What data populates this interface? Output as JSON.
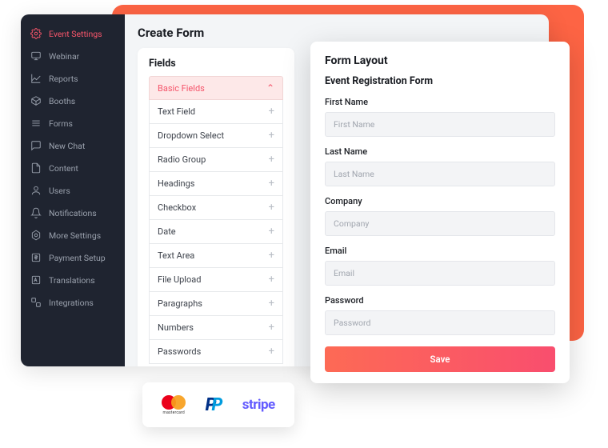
{
  "sidebar": {
    "items": [
      {
        "label": "Event Settings",
        "icon": "gear-icon",
        "active": true
      },
      {
        "label": "Webinar",
        "icon": "monitor-icon"
      },
      {
        "label": "Reports",
        "icon": "chart-icon"
      },
      {
        "label": "Booths",
        "icon": "cube-icon"
      },
      {
        "label": "Forms",
        "icon": "rows-icon"
      },
      {
        "label": "New Chat",
        "icon": "chat-icon"
      },
      {
        "label": "Content",
        "icon": "file-icon"
      },
      {
        "label": "Users",
        "icon": "user-icon"
      },
      {
        "label": "Notifications",
        "icon": "bell-icon"
      },
      {
        "label": "More Settings",
        "icon": "hex-gear-icon"
      },
      {
        "label": "Payment Setup",
        "icon": "dollar-icon"
      },
      {
        "label": "Translations",
        "icon": "translate-icon"
      },
      {
        "label": "Integrations",
        "icon": "integrations-icon"
      }
    ]
  },
  "main": {
    "title": "Create Form",
    "fields_title": "Fields",
    "group_label": "Basic Fields",
    "field_types": [
      "Text Field",
      "Dropdown Select",
      "Radio Group",
      "Headings",
      "Checkbox",
      "Date",
      "Text Area",
      "File Upload",
      "Paragraphs",
      "Numbers",
      "Passwords"
    ]
  },
  "form_panel": {
    "title": "Form Layout",
    "subtitle": "Event Registration Form",
    "fields": [
      {
        "label": "First Name",
        "placeholder": "First Name"
      },
      {
        "label": "Last Name",
        "placeholder": "Last Name"
      },
      {
        "label": "Company",
        "placeholder": "Company"
      },
      {
        "label": "Email",
        "placeholder": "Email"
      },
      {
        "label": "Password",
        "placeholder": "Password"
      }
    ],
    "save_label": "Save"
  },
  "payments": {
    "mastercard_label": "mastercard",
    "stripe_label": "stripe"
  }
}
